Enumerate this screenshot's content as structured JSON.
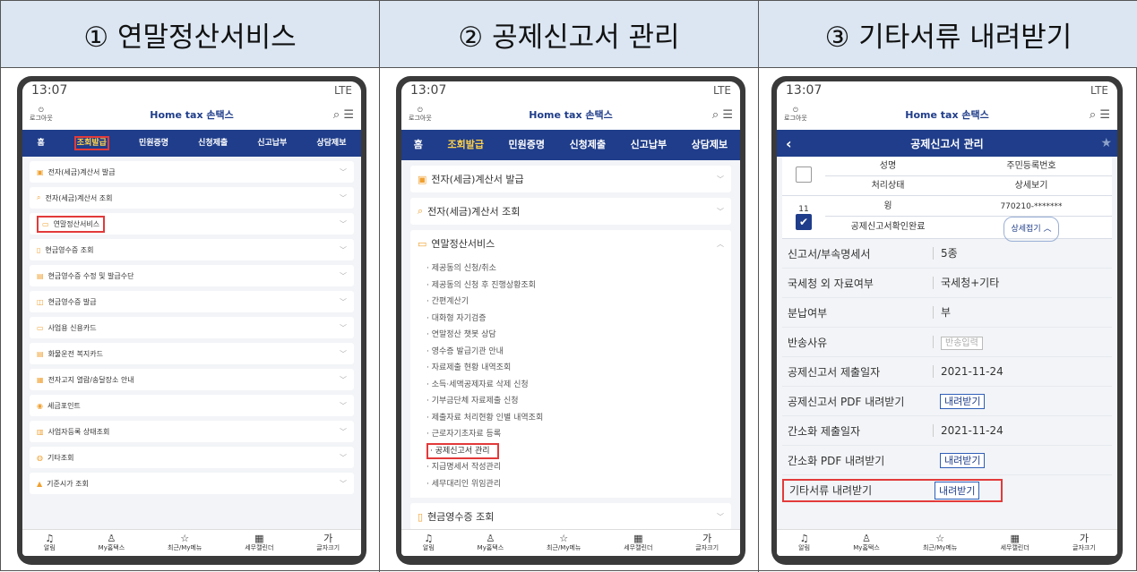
{
  "headers": [
    "① 연말정산서비스",
    "② 공제신고서 관리",
    "③ 기타서류 내려받기"
  ],
  "status": {
    "time": "13:07",
    "signal": "LTE"
  },
  "topbar": {
    "login": "로그아웃",
    "logo": "Home tax 손택스"
  },
  "nav": [
    "홈",
    "조회발급",
    "민원증명",
    "신청제출",
    "신고납부",
    "상담제보"
  ],
  "panel1": {
    "items": [
      "전자(세금)계산서 발급",
      "전자(세금)계산서 조회",
      "연말정산서비스",
      "현금영수증 조회",
      "현금영수증 수정 및 발급수단",
      "현금영수증 발급",
      "사업용 신용카드",
      "화물운전 복지카드",
      "전자고지 열람/송달장소 안내",
      "세금포인트",
      "사업자등록 상태조회",
      "기타조회",
      "기준시가 조회"
    ]
  },
  "panel2": {
    "items_top": [
      "전자(세금)계산서 발급",
      "전자(세금)계산서 조회",
      "연말정산서비스"
    ],
    "sub": [
      "· 제공동의 신청/취소",
      "· 제공동의 신청 후 진행상황조회",
      "· 간편계산기",
      "· 대화형 자기검증",
      "· 연말정산 챗봇 상담",
      "· 영수증 발급기관 안내",
      "· 자료제출 현황 내역조회",
      "· 소득·세액공제자료 삭제 신청",
      "· 기부금단체 자료제출 신청",
      "· 제출자료 처리현황 인별 내역조회",
      "· 근로자기초자료 등록",
      "· 공제신고서 관리",
      "· 지급명세서 작성관리",
      "· 세무대리인 위임관리"
    ],
    "item_bottom": "현금영수증 조회"
  },
  "panel3": {
    "title": "공제신고서 관리",
    "table_head": [
      "성명",
      "주민등록번호",
      "처리상태",
      "상세보기"
    ],
    "row": {
      "num": "11",
      "name": "윙",
      "rrn": "770210-*******",
      "state": "공제신고서확인완료",
      "btn": "상세접기 ︿"
    },
    "details": [
      {
        "k": "신고서/부속명세서",
        "v": "5종"
      },
      {
        "k": "국세청 외 자료여부",
        "v": "국세청+기타"
      },
      {
        "k": "분납여부",
        "v": "부"
      },
      {
        "k": "반송사유",
        "v": "반송입력"
      },
      {
        "k": "공제신고서 제출일자",
        "v": "2021-11-24"
      },
      {
        "k": "공제신고서 PDF 내려받기",
        "v": "내려받기"
      },
      {
        "k": "간소화 제출일자",
        "v": "2021-11-24"
      },
      {
        "k": "간소화 PDF 내려받기",
        "v": "내려받기"
      },
      {
        "k": "기타서류 내려받기",
        "v": "내려받기"
      }
    ]
  },
  "bottom": [
    "알림",
    "My홈택스",
    "최근/My메뉴",
    "세무캘린더",
    "글자크기"
  ],
  "colors": {
    "navy": "#1f3d8a",
    "highlight": "#e23a3a",
    "header_bg": "#dbe6f2"
  }
}
